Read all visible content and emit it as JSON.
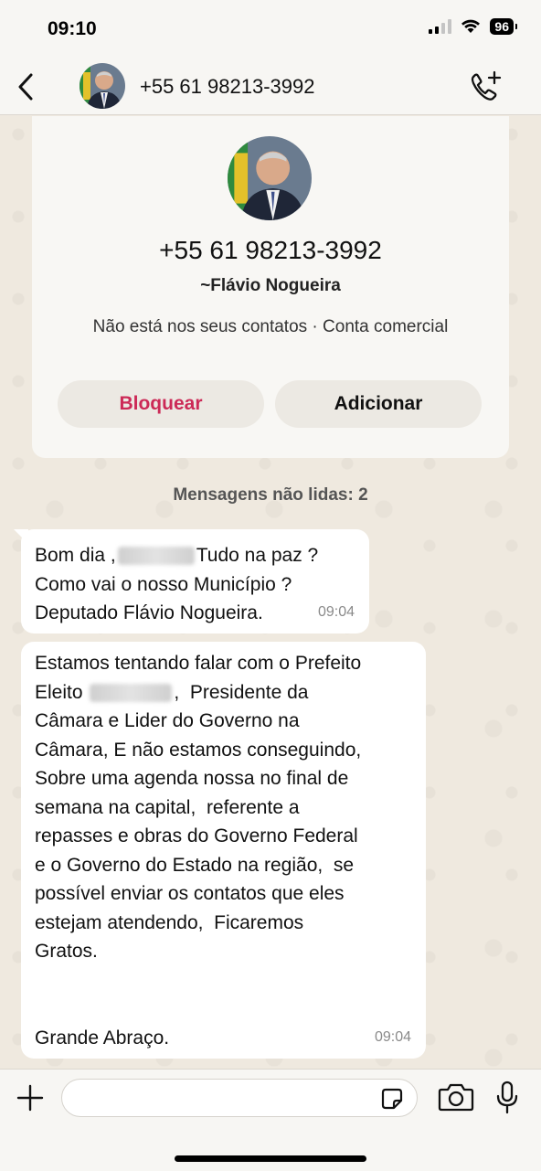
{
  "status_bar": {
    "time": "09:10",
    "battery": "96"
  },
  "header": {
    "back_icon": "chevron-left-icon",
    "title": "+55 61 98213-3992",
    "call_icon": "phone-plus-icon"
  },
  "contact_card": {
    "phone": "+55 61 98213-3992",
    "name": "~Flávio Nogueira",
    "info": "Não está nos seus contatos · Conta comercial",
    "block_label": "Bloquear",
    "add_label": "Adicionar"
  },
  "unread_label": "Mensagens não lidas: 2",
  "messages": [
    {
      "lines": {
        "l1a": "Bom dia ,",
        "l1b": "Tudo na paz ?",
        "l2": "Como vai o nosso Município ?",
        "l3": "Deputado Flávio Nogueira."
      },
      "time": "09:04"
    },
    {
      "lines": {
        "l1": "Estamos tentando falar com o Prefeito",
        "l2a": "Eleito",
        "l2b": ",  Presidente da",
        "l3": "Câmara e Lider do Governo na",
        "l4": "Câmara, E não estamos conseguindo,",
        "l5": "Sobre uma agenda nossa no final de",
        "l6": "semana na capital,  referente a",
        "l7": "repasses e obras do Governo Federal",
        "l8": "e o Governo do Estado na região,  se",
        "l9": "possível enviar os contatos que eles",
        "l10": "estejam atendendo,  Ficaremos",
        "l11": "Gratos.",
        "l12": "Grande Abraço."
      },
      "time": "09:04"
    }
  ],
  "input_bar": {
    "plus_icon": "plus-icon",
    "sticker_icon": "sticker-icon",
    "camera_icon": "camera-icon",
    "mic_icon": "microphone-icon"
  },
  "colors": {
    "block_red": "#cc2a57",
    "chat_bg": "#efe9df"
  }
}
